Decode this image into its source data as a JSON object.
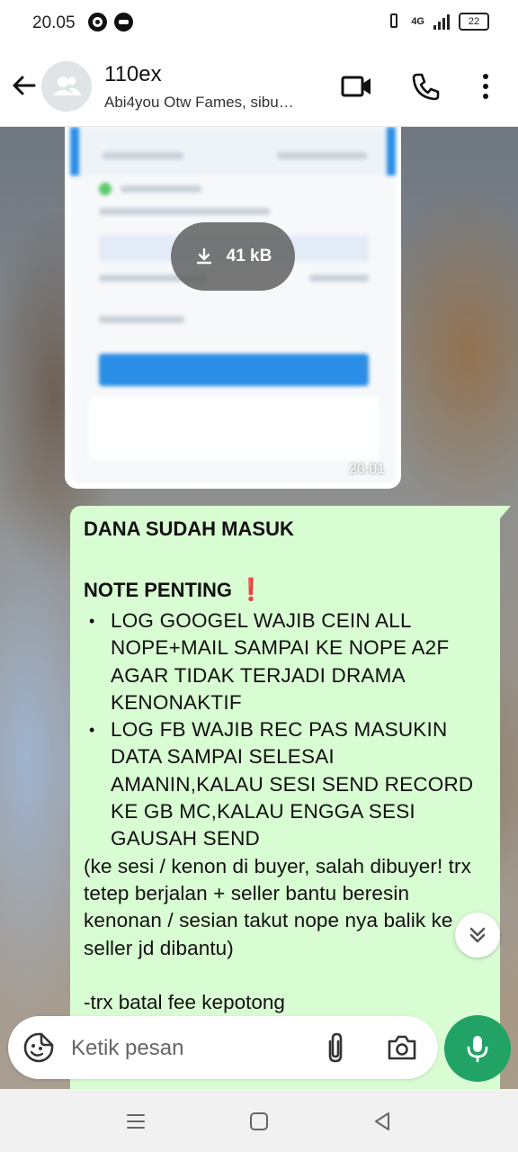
{
  "status_bar": {
    "time": "20.05",
    "network": "4G",
    "battery": "22",
    "icons": [
      "whatsapp-icon",
      "notification-icon",
      "vibrate-icon",
      "signal-icon",
      "battery-icon"
    ]
  },
  "header": {
    "title": "110ex",
    "subtitle": "Abi4you Otw Fames, sibu…",
    "icons": [
      "back-arrow-icon",
      "group-avatar-icon",
      "video-call-icon",
      "phone-icon",
      "more-vertical-icon"
    ]
  },
  "messages": {
    "image": {
      "download_size": "41 kB",
      "time": "20.01"
    },
    "text": {
      "heading": "DANA SUDAH MASUK",
      "note_title": "NOTE PENTING",
      "note_emoji": "❗",
      "bullets": [
        "LOG GOOGEL WAJIB CEIN ALL NOPE+MAIL SAMPAI KE NOPE A2F AGAR TIDAK TERJADI DRAMA KENONAKTIF",
        "LOG FB WAJIB REC PAS MASUKIN DATA SAMPAI SELESAI AMANIN,KALAU SESI SEND RECORD KE GB MC,KALAU ENGGA SESI GAUSAH SEND"
      ],
      "paragraph": "(ke sesi / kenon di buyer, salah dibuyer! trx tetep berjalan + seller bantu beresin kenonan / sesian takut nope nya balik ke seller jd dibantu)",
      "tail": "-trx batal fee kepotong"
    }
  },
  "composer": {
    "placeholder": "Ketik pesan"
  },
  "colors": {
    "bubble_outgoing": "#d9fdd3",
    "accent_green": "#21a366",
    "header_bg": "#ffffff"
  }
}
